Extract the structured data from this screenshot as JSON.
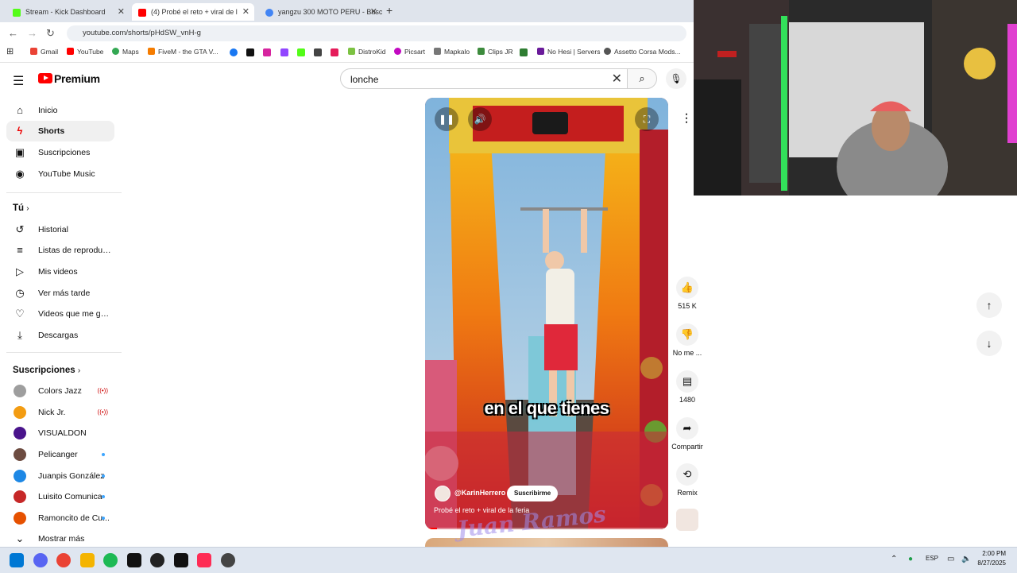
{
  "browser": {
    "tabs": [
      {
        "title": "Stream - Kick Dashboard",
        "favicon_color": "#53fc18"
      },
      {
        "title": "(4) Probé el reto + viral de l",
        "favicon_color": "#ff0000",
        "active": true
      },
      {
        "title": "yangzu 300 MOTO PERU - Busc",
        "favicon_color": "#4285f4"
      }
    ],
    "new_tab": "+",
    "url": "youtube.com/shorts/pHdSW_vnH-g",
    "bookmarks": [
      {
        "label": "Gmail",
        "color": "#ea4335"
      },
      {
        "label": "YouTube",
        "color": "#ff0000"
      },
      {
        "label": "Maps",
        "color": "#34a853"
      },
      {
        "label": "FiveM - the GTA V...",
        "color": "#f57c00"
      },
      {
        "label": "DistroKid",
        "color": "#7cc242"
      },
      {
        "label": "Picsart",
        "color": "#c209c1"
      },
      {
        "label": "Mapkalo",
        "color": "#777777"
      },
      {
        "label": "Clips JR",
        "color": "#3d8b3d"
      },
      {
        "label": "No Hesi | Servers",
        "color": "#6a1b9a"
      },
      {
        "label": "Assetto Corsa Mods...",
        "color": "#555555"
      }
    ]
  },
  "header": {
    "logo_text": "Premium",
    "search_value": "lonche",
    "search_placeholder": "Buscar"
  },
  "sidebar": {
    "main": [
      {
        "label": "Inicio",
        "icon": "home-icon",
        "glyph": "⌂"
      },
      {
        "label": "Shorts",
        "icon": "shorts-icon",
        "glyph": "ϟ",
        "active": true
      },
      {
        "label": "Suscripciones",
        "icon": "subscriptions-icon",
        "glyph": "▣"
      },
      {
        "label": "YouTube Music",
        "icon": "music-icon",
        "glyph": "◉"
      }
    ],
    "you_heading": "Tú",
    "you": [
      {
        "label": "Historial",
        "icon": "history-icon",
        "glyph": "↺"
      },
      {
        "label": "Listas de reproducc...",
        "icon": "playlist-icon",
        "glyph": "≡"
      },
      {
        "label": "Mis videos",
        "icon": "my-videos-icon",
        "glyph": "▷"
      },
      {
        "label": "Ver más tarde",
        "icon": "watch-later-icon",
        "glyph": "◷"
      },
      {
        "label": "Videos que me gus...",
        "icon": "liked-icon",
        "glyph": "♡"
      },
      {
        "label": "Descargas",
        "icon": "download-icon",
        "glyph": "⤓"
      }
    ],
    "subs_heading": "Suscripciones",
    "subs": [
      {
        "label": "Colors Jazz",
        "avatar_color": "#9e9e9e",
        "status": "live",
        "live_glyph": "((•))"
      },
      {
        "label": "Nick Jr.",
        "avatar_color": "#f39c12",
        "status": "live",
        "live_glyph": "((•))"
      },
      {
        "label": "VISUALDON",
        "avatar_color": "#4a148c",
        "status": "none"
      },
      {
        "label": "Pelicanger",
        "avatar_color": "#6d4c41",
        "status": "new"
      },
      {
        "label": "Juanpis González",
        "avatar_color": "#1e88e5",
        "status": "new"
      },
      {
        "label": "Luisito Comunica",
        "avatar_color": "#c62828",
        "status": "new"
      },
      {
        "label": "Ramoncito de Cu...",
        "avatar_color": "#e65100",
        "status": "new"
      }
    ],
    "show_more": "Mostrar más"
  },
  "video": {
    "caption": "en el que tienes",
    "channel_handle": "@KarinHerrero",
    "subscribe_label": "Suscribirme",
    "title": "Probé el reto + viral de la feria",
    "progress": 0.05
  },
  "actions": {
    "likes": "515 K",
    "dislike_label": "No me ...",
    "comments": "1480",
    "share_label": "Compartir",
    "remix_label": "Remix"
  },
  "watermark_text": "Juan Ramos",
  "taskbar": {
    "apps": [
      {
        "name": "start-icon",
        "color": "#0078d4"
      },
      {
        "name": "discord-icon",
        "color": "#5865f2"
      },
      {
        "name": "chrome-icon",
        "color": "#ea4335"
      },
      {
        "name": "file-explorer-icon",
        "color": "#f4b400"
      },
      {
        "name": "spotify-icon",
        "color": "#1db954"
      },
      {
        "name": "capcut-icon",
        "color": "#111111"
      },
      {
        "name": "chatgpt-icon",
        "color": "#222222"
      },
      {
        "name": "tiktok-icon",
        "color": "#111111"
      },
      {
        "name": "tiktok-studio-icon",
        "color": "#fe2c55"
      },
      {
        "name": "app-icon",
        "color": "#444444"
      }
    ],
    "language": "ESP",
    "time": "2:00 PM",
    "date": "8/27/2025"
  }
}
